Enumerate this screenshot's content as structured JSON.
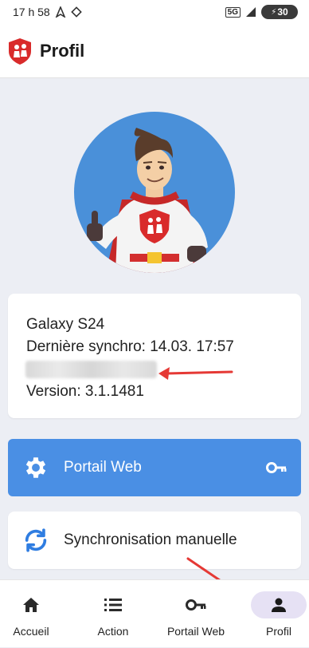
{
  "status_bar": {
    "time": "17 h 58",
    "network": "5G",
    "battery": "30"
  },
  "app_bar": {
    "title": "Profil",
    "logo": "shield-logo"
  },
  "profile": {
    "device": "Galaxy S24",
    "last_sync": "Dernière synchro: 14.03. 17:57",
    "version": "Version: 3.1.1481"
  },
  "actions": {
    "portal_label": "Portail Web",
    "sync_label": "Synchronisation manuelle"
  },
  "bottom_nav": {
    "items": [
      {
        "label": "Accueil",
        "icon": "home-icon"
      },
      {
        "label": "Action",
        "icon": "list-icon"
      },
      {
        "label": "Portail Web",
        "icon": "key-icon"
      },
      {
        "label": "Profil",
        "icon": "person-icon",
        "active": true
      }
    ]
  },
  "colors": {
    "accent_blue": "#4a8fe4",
    "brand_red": "#d92b2b",
    "annotation_red": "#e53935",
    "background": "#eceef4"
  }
}
